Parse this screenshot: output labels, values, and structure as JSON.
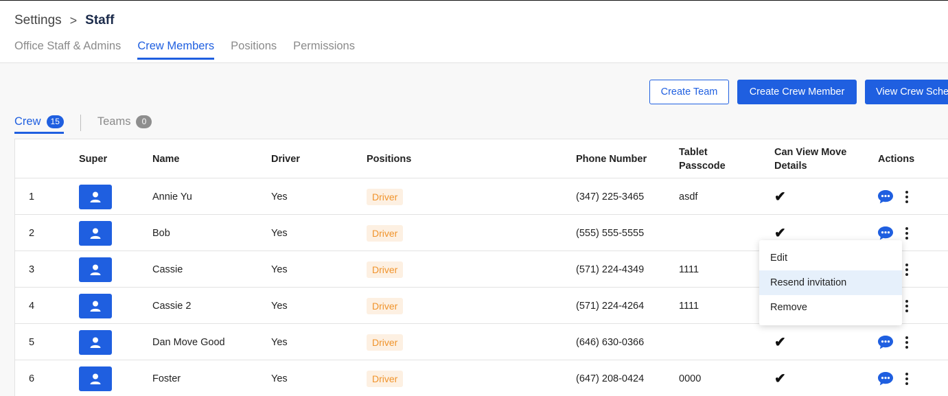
{
  "breadcrumb": {
    "root": "Settings",
    "separator": ">",
    "current": "Staff"
  },
  "tabs": [
    {
      "label": "Office Staff & Admins",
      "active": false
    },
    {
      "label": "Crew Members",
      "active": true
    },
    {
      "label": "Positions",
      "active": false
    },
    {
      "label": "Permissions",
      "active": false
    }
  ],
  "actions": {
    "create_team": "Create Team",
    "create_crew_member": "Create Crew Member",
    "view_crew_schedule": "View Crew Sche"
  },
  "subtabs": {
    "crew": {
      "label": "Crew",
      "count": "15"
    },
    "teams": {
      "label": "Teams",
      "count": "0"
    }
  },
  "table": {
    "headers": {
      "super": "Super",
      "name": "Name",
      "driver": "Driver",
      "positions": "Positions",
      "phone": "Phone Number",
      "tablet_passcode": "Tablet Passcode",
      "can_view_move_details": "Can View Move Details",
      "actions": "Actions"
    },
    "rows": [
      {
        "index": "1",
        "name": "Annie Yu",
        "driver": "Yes",
        "position": "Driver",
        "phone": "(347) 225-3465",
        "passcode": "asdf",
        "can_view": true
      },
      {
        "index": "2",
        "name": "Bob",
        "driver": "Yes",
        "position": "Driver",
        "phone": "(555) 555-5555",
        "passcode": "",
        "can_view": true
      },
      {
        "index": "3",
        "name": "Cassie",
        "driver": "Yes",
        "position": "Driver",
        "phone": "(571) 224-4349",
        "passcode": "1111",
        "can_view": false
      },
      {
        "index": "4",
        "name": "Cassie 2",
        "driver": "Yes",
        "position": "Driver",
        "phone": "(571) 224-4264",
        "passcode": "1111",
        "can_view": false
      },
      {
        "index": "5",
        "name": "Dan Move Good",
        "driver": "Yes",
        "position": "Driver",
        "phone": "(646) 630-0366",
        "passcode": "",
        "can_view": true
      },
      {
        "index": "6",
        "name": "Foster",
        "driver": "Yes",
        "position": "Driver",
        "phone": "(647) 208-0424",
        "passcode": "0000",
        "can_view": true
      }
    ]
  },
  "dropdown": {
    "items": [
      {
        "label": "Edit",
        "highlighted": false
      },
      {
        "label": "Resend invitation",
        "highlighted": true
      },
      {
        "label": "Remove",
        "highlighted": false
      }
    ]
  },
  "icons": {
    "avatar": "user-icon",
    "check": "check-icon",
    "chat": "chat-bubble-icon",
    "more": "kebab-menu-icon",
    "separator": "chevron-right-icon"
  },
  "colors": {
    "accent": "#1f5fe0",
    "tag_bg": "#fdf0e2",
    "tag_text": "#f0932b",
    "dropdown_hover": "#e6f0fb"
  }
}
